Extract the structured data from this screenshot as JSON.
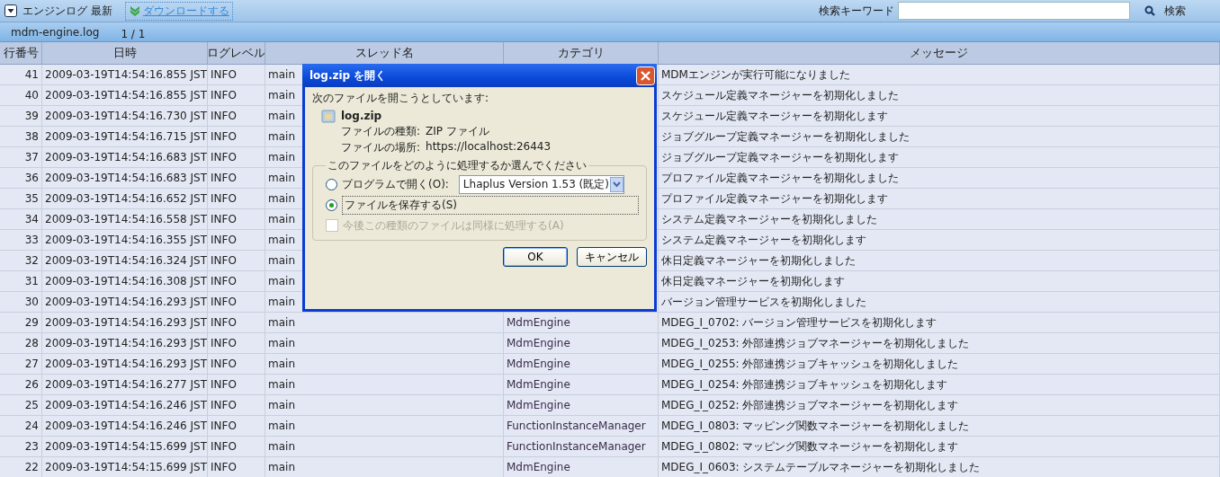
{
  "toolbar": {
    "title": "エンジンログ 最新",
    "download": "ダウンロードする",
    "search_label": "検索キーワード",
    "search_button": "検索"
  },
  "subbar": {
    "file": "mdm-engine.log",
    "page": "1 / 1"
  },
  "table": {
    "columns": [
      "行番号",
      "日時",
      "ログレベル",
      "スレッド名",
      "カテゴリ",
      "メッセージ"
    ],
    "rows": [
      {
        "no": "41",
        "time": "2009-03-19T14:54:16.855 JST",
        "level": "INFO",
        "thread": "main",
        "category": "",
        "message": "MDMエンジンが実行可能になりました"
      },
      {
        "no": "40",
        "time": "2009-03-19T14:54:16.855 JST",
        "level": "INFO",
        "thread": "main",
        "category": "",
        "message": "スケジュール定義マネージャーを初期化しました"
      },
      {
        "no": "39",
        "time": "2009-03-19T14:54:16.730 JST",
        "level": "INFO",
        "thread": "main",
        "category": "",
        "message": "スケジュール定義マネージャーを初期化します"
      },
      {
        "no": "38",
        "time": "2009-03-19T14:54:16.715 JST",
        "level": "INFO",
        "thread": "main",
        "category": "",
        "message": "ジョブグループ定義マネージャーを初期化しました"
      },
      {
        "no": "37",
        "time": "2009-03-19T14:54:16.683 JST",
        "level": "INFO",
        "thread": "main",
        "category": "",
        "message": "ジョブグループ定義マネージャーを初期化します"
      },
      {
        "no": "36",
        "time": "2009-03-19T14:54:16.683 JST",
        "level": "INFO",
        "thread": "main",
        "category": "",
        "message": "プロファイル定義マネージャーを初期化しました"
      },
      {
        "no": "35",
        "time": "2009-03-19T14:54:16.652 JST",
        "level": "INFO",
        "thread": "main",
        "category": "",
        "message": "プロファイル定義マネージャーを初期化します"
      },
      {
        "no": "34",
        "time": "2009-03-19T14:54:16.558 JST",
        "level": "INFO",
        "thread": "main",
        "category": "",
        "message": "システム定義マネージャーを初期化しました"
      },
      {
        "no": "33",
        "time": "2009-03-19T14:54:16.355 JST",
        "level": "INFO",
        "thread": "main",
        "category": "",
        "message": "システム定義マネージャーを初期化します"
      },
      {
        "no": "32",
        "time": "2009-03-19T14:54:16.324 JST",
        "level": "INFO",
        "thread": "main",
        "category": "",
        "message": "休日定義マネージャーを初期化しました"
      },
      {
        "no": "31",
        "time": "2009-03-19T14:54:16.308 JST",
        "level": "INFO",
        "thread": "main",
        "category": "",
        "message": "休日定義マネージャーを初期化します"
      },
      {
        "no": "30",
        "time": "2009-03-19T14:54:16.293 JST",
        "level": "INFO",
        "thread": "main",
        "category": "",
        "message": "バージョン管理サービスを初期化しました"
      },
      {
        "no": "29",
        "time": "2009-03-19T14:54:16.293 JST",
        "level": "INFO",
        "thread": "main",
        "category": "MdmEngine",
        "message": "MDEG_I_0702: バージョン管理サービスを初期化します"
      },
      {
        "no": "28",
        "time": "2009-03-19T14:54:16.293 JST",
        "level": "INFO",
        "thread": "main",
        "category": "MdmEngine",
        "message": "MDEG_I_0253: 外部連携ジョブマネージャーを初期化しました"
      },
      {
        "no": "27",
        "time": "2009-03-19T14:54:16.293 JST",
        "level": "INFO",
        "thread": "main",
        "category": "MdmEngine",
        "message": "MDEG_I_0255: 外部連携ジョブキャッシュを初期化しました"
      },
      {
        "no": "26",
        "time": "2009-03-19T14:54:16.277 JST",
        "level": "INFO",
        "thread": "main",
        "category": "MdmEngine",
        "message": "MDEG_I_0254: 外部連携ジョブキャッシュを初期化します"
      },
      {
        "no": "25",
        "time": "2009-03-19T14:54:16.246 JST",
        "level": "INFO",
        "thread": "main",
        "category": "MdmEngine",
        "message": "MDEG_I_0252: 外部連携ジョブマネージャーを初期化します"
      },
      {
        "no": "24",
        "time": "2009-03-19T14:54:16.246 JST",
        "level": "INFO",
        "thread": "main",
        "category": "FunctionInstanceManager",
        "message": "MDEG_I_0803: マッピング関数マネージャーを初期化しました"
      },
      {
        "no": "23",
        "time": "2009-03-19T14:54:15.699 JST",
        "level": "INFO",
        "thread": "main",
        "category": "FunctionInstanceManager",
        "message": "MDEG_I_0802: マッピング関数マネージャーを初期化します"
      },
      {
        "no": "22",
        "time": "2009-03-19T14:54:15.699 JST",
        "level": "INFO",
        "thread": "main",
        "category": "MdmEngine",
        "message": "MDEG_I_0603: システムテーブルマネージャーを初期化しました"
      }
    ]
  },
  "dialog": {
    "title": "log.zip を開く",
    "intro": "次のファイルを開こうとしています:",
    "file_name": "log.zip",
    "details": [
      {
        "label": "ファイルの種類:",
        "value": "ZIP ファイル"
      },
      {
        "label": "ファイルの場所:",
        "value": "https://localhost:26443"
      }
    ],
    "group": "このファイルをどのように処理するか選んでください",
    "options": [
      {
        "label": "プログラムで開く(O):",
        "selected": false,
        "program": "Lhaplus Version 1.53 (既定)"
      },
      {
        "label": "ファイルを保存する(S)",
        "selected": true
      }
    ],
    "remember": {
      "label": "今後この種類のファイルは同様に処理する(A)",
      "checked": false,
      "disabled": true
    },
    "buttons": [
      "OK",
      "キャンセル"
    ]
  }
}
